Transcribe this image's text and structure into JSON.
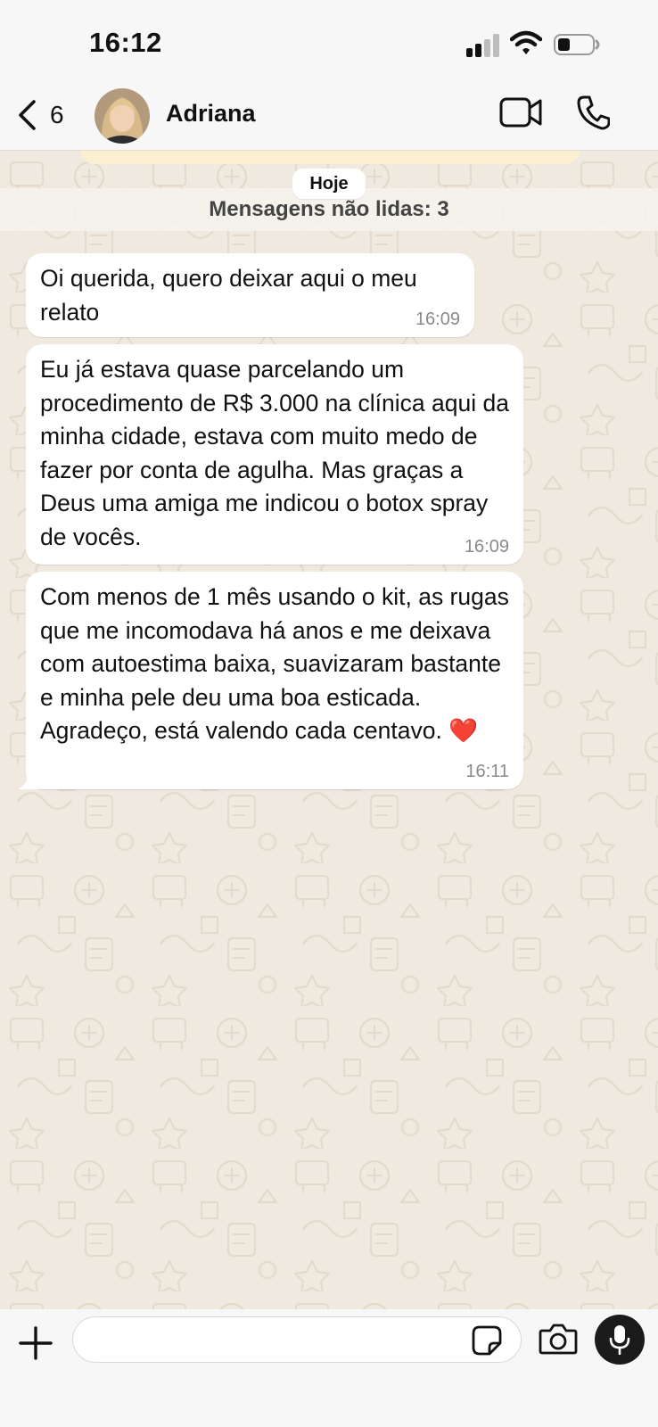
{
  "status_bar": {
    "time": "16:12"
  },
  "header": {
    "back_count": "6",
    "contact_name": "Adriana"
  },
  "chat": {
    "date_label": "Hoje",
    "unread_label": "Mensagens não lidas: 3",
    "messages": [
      {
        "text": "Oi querida, quero deixar aqui o meu relato",
        "time": "16:09"
      },
      {
        "text": "Eu já estava quase parcelando um procedimento de R$ 3.000 na clínica aqui da minha cidade, estava com muito medo de fazer por conta de agulha. Mas graças a Deus uma amiga me indicou o botox spray de vocês.",
        "time": "16:09"
      },
      {
        "text": "Com menos de 1 mês usando o kit, as rugas que me incomodava há anos e me deixava com autoestima baixa, suavizaram bastante e minha pele deu uma boa esticada. Agradeço, está valendo cada centavo. ❤️",
        "time": "16:11"
      }
    ]
  },
  "composer": {
    "input_value": ""
  },
  "colors": {
    "chat_background": "#efe9df",
    "bubble": "#ffffff",
    "bars": "#f7f7f7",
    "pinned_banner": "#fbf0d2",
    "heart": "#e0242b"
  },
  "icons": [
    "back-chevron-icon",
    "video-call-icon",
    "phone-call-icon",
    "plus-icon",
    "sticker-icon",
    "camera-icon",
    "microphone-icon",
    "signal-icon",
    "wifi-icon",
    "battery-icon"
  ]
}
